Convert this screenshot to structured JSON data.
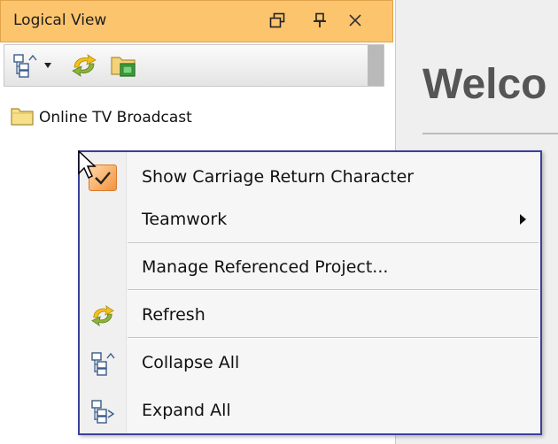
{
  "panel": {
    "title": "Logical View",
    "controls": {
      "restore": "restore-icon",
      "pin": "pin-icon",
      "close": "close-icon"
    },
    "toolbar": {
      "collapse_icon": "collapse-tree-icon",
      "dropdown_icon": "chevron-down-icon",
      "refresh_icon": "refresh-icon",
      "folder_icon": "folder-add-icon"
    },
    "tree": {
      "root": {
        "label": "Online TV Broadcast",
        "icon": "folder-icon"
      }
    }
  },
  "welcome": {
    "title_visible": "Welco"
  },
  "context_menu": {
    "items": [
      {
        "label": "Show Carriage Return Character",
        "icon": "checkmark-icon",
        "checked": true
      },
      {
        "label": "Teamwork",
        "has_submenu": true
      },
      {
        "label": "Manage Referenced Project..."
      },
      {
        "label": "Refresh",
        "icon": "refresh-icon"
      },
      {
        "label": "Collapse All",
        "icon": "collapse-all-icon"
      },
      {
        "label": "Expand All",
        "icon": "expand-all-icon"
      }
    ]
  },
  "colors": {
    "title_bar": "#fdc46e",
    "menu_border": "#3b3f9e",
    "check_accent": "#f3923f",
    "refresh_green": "#8db33a",
    "refresh_yellow": "#f2c21b"
  }
}
